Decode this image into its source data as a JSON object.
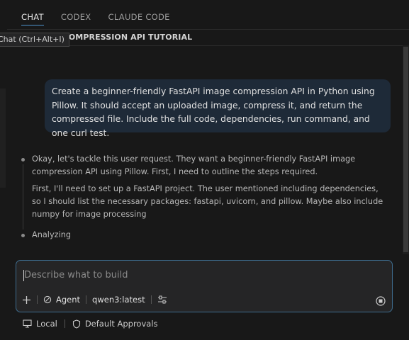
{
  "tabs": [
    {
      "label": "CHAT",
      "active": true
    },
    {
      "label": "CODEX",
      "active": false
    },
    {
      "label": "CLAUDE CODE",
      "active": false
    }
  ],
  "title": "GE COMPRESSION API TUTORIAL",
  "tooltip": "Chat (Ctrl+Alt+I)",
  "user_message": "Create a beginner-friendly FastAPI image compression API in Python using Pillow. It should accept an uploaded image, compress it, and return the compressed file. Include the full code, dependencies, run command, and one curl test.",
  "thinking": {
    "paragraph1": "Okay, let's tackle this user request. They want a beginner-friendly FastAPI image compression API using Pillow. First, I need to outline the steps required.",
    "paragraph2": "First, I'll need to set up a FastAPI project. The user mentioned including dependencies, so I should list the necessary packages: fastapi, uvicorn, and pillow. Maybe also include numpy for image processing",
    "status": "Analyzing"
  },
  "input": {
    "placeholder": "Describe what to build",
    "mode_label": "Agent",
    "model_label": "qwen3:latest"
  },
  "footer": {
    "local_label": "Local",
    "approvals_label": "Default Approvals"
  },
  "colors": {
    "accent": "#4e94ce",
    "bubble": "#1e2a38",
    "background": "#181818"
  }
}
